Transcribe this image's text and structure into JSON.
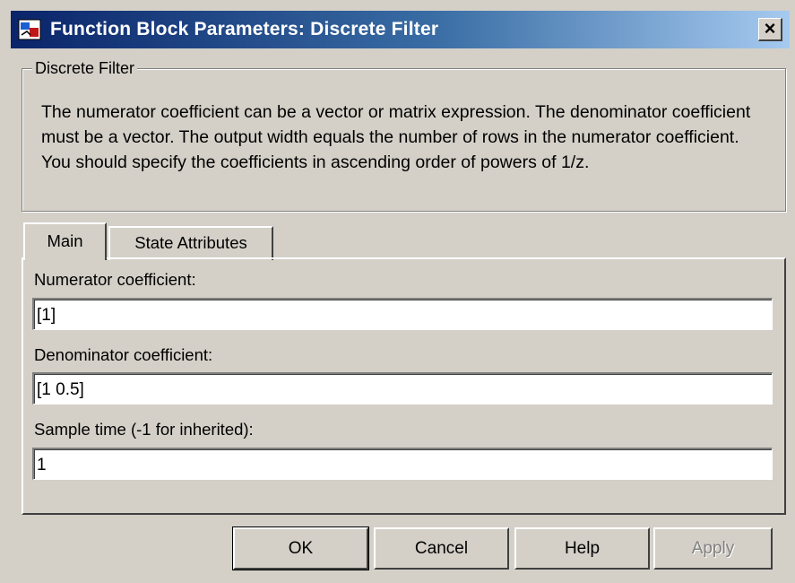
{
  "window": {
    "title": "Function Block Parameters: Discrete Filter",
    "close_label": "×",
    "app_icon": "simulink-block-icon",
    "titlebar_colors": [
      "#0a246a",
      "#a6caf0"
    ]
  },
  "block": {
    "group_title": "Discrete Filter",
    "description": "The numerator coefficient can be a vector or matrix expression. The denominator coefficient must be a vector. The output width equals the number of rows in the numerator coefficient. You should specify the coefficients in ascending order of powers of 1/z."
  },
  "tabs": [
    {
      "label": "Main",
      "active": true
    },
    {
      "label": "State Attributes",
      "active": false
    }
  ],
  "fields": {
    "numerator": {
      "label": "Numerator coefficient:",
      "value": "[1]"
    },
    "denominator": {
      "label": "Denominator coefficient:",
      "value": "[1 0.5]"
    },
    "sample_time": {
      "label": "Sample time (-1 for inherited):",
      "value": "1"
    }
  },
  "buttons": {
    "ok": "OK",
    "cancel": "Cancel",
    "help": "Help",
    "apply": "Apply",
    "apply_enabled": false
  }
}
